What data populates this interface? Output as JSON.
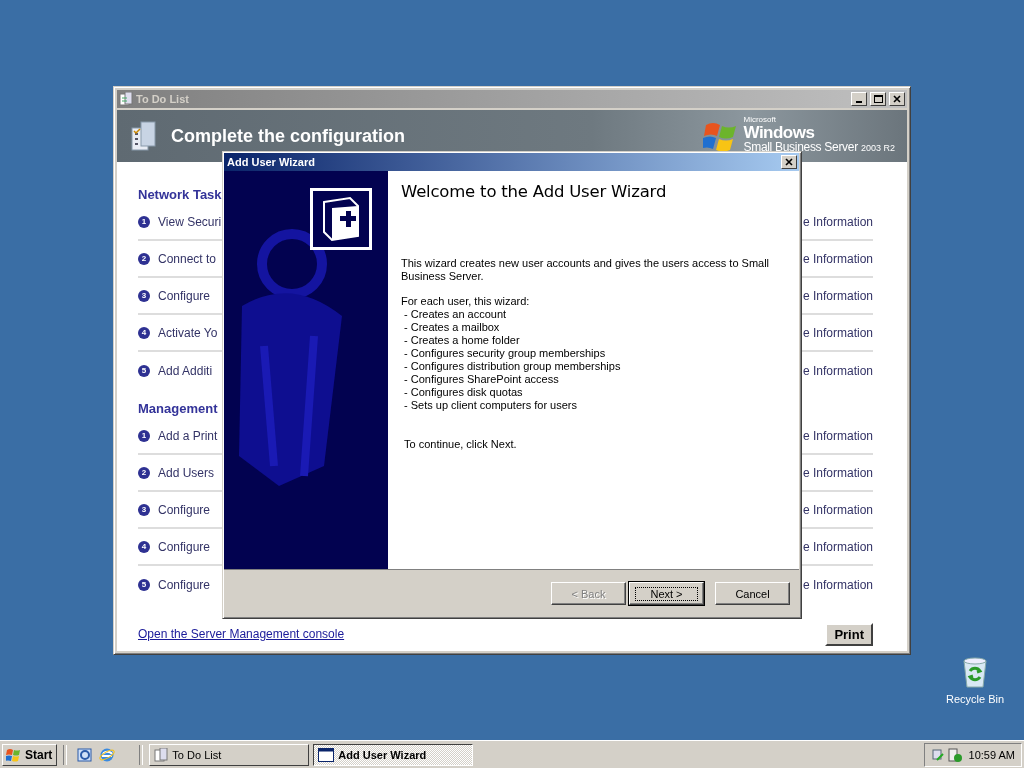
{
  "desktop": {
    "icons": [
      {
        "label": "Recycle Bin"
      }
    ]
  },
  "todo_window": {
    "title": "To Do List",
    "header": "Complete the configuration",
    "logo": {
      "maker": "Microsoft",
      "brand": "Windows",
      "product": "Small Business Server",
      "version": "2003 R2"
    },
    "sections": [
      {
        "title": "Network Task",
        "items": [
          {
            "number": "1",
            "left_text": "View Securi",
            "right_text": "e Information"
          },
          {
            "number": "2",
            "left_text": "Connect to",
            "right_text": "e Information"
          },
          {
            "number": "3",
            "left_text": "Configure",
            "right_text": "e Information"
          },
          {
            "number": "4",
            "left_text": "Activate Yo",
            "right_text": "e Information"
          },
          {
            "number": "5",
            "left_text": "Add Additi",
            "right_text": "e Information"
          }
        ]
      },
      {
        "title": "Management",
        "items": [
          {
            "number": "1",
            "left_text": "Add a Print",
            "right_text": "e Information"
          },
          {
            "number": "2",
            "left_text": "Add Users",
            "right_text": "e Information"
          },
          {
            "number": "3",
            "left_text": "Configure",
            "right_text": "e Information"
          },
          {
            "number": "4",
            "left_text": "Configure",
            "right_text": "e Information"
          },
          {
            "number": "5",
            "left_text": "Configure",
            "right_text": "e Information"
          }
        ]
      }
    ],
    "link": "Open the Server Management console",
    "print_button": "Print"
  },
  "wizard": {
    "title": "Add User Wizard",
    "heading": "Welcome to the Add User Wizard",
    "intro": "This wizard creates new user accounts and gives the users access to Small Business Server.",
    "list_title": "For each user, this wizard:",
    "bullets": [
      "- Creates an account",
      "- Creates a mailbox",
      "- Creates a home folder",
      "- Configures security group memberships",
      "- Configures distribution group memberships",
      "- Configures SharePoint access",
      "- Configures disk quotas",
      "- Sets up client computers for users"
    ],
    "continue_text": "To continue, click Next.",
    "buttons": [
      {
        "label": "< Back",
        "disabled": true,
        "default": false
      },
      {
        "label": "Next >",
        "disabled": false,
        "default": true
      },
      {
        "label": "Cancel",
        "disabled": false,
        "default": false
      }
    ]
  },
  "taskbar": {
    "start": "Start",
    "tasks": [
      {
        "label": "To Do List",
        "selected": false
      },
      {
        "label": "Add User Wizard",
        "selected": true
      }
    ],
    "clock": "10:59 AM"
  }
}
